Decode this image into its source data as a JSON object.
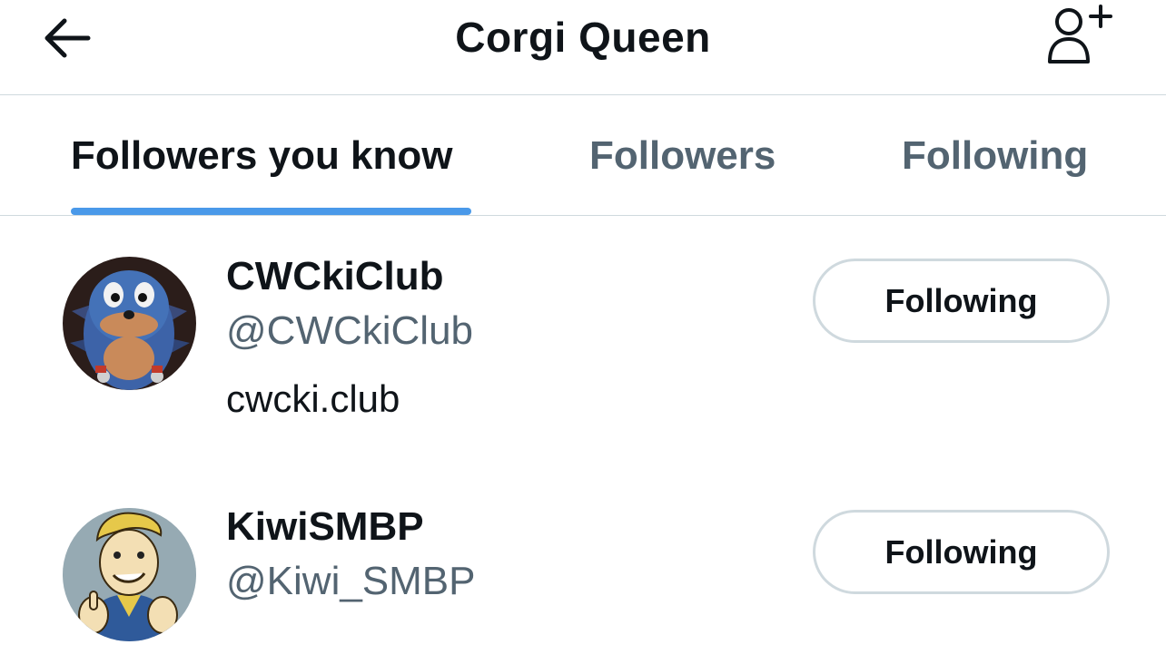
{
  "header": {
    "title": "Corgi Queen",
    "back_icon": "arrow-left-icon",
    "add_user_icon": "person-plus-icon"
  },
  "tabs": [
    {
      "label": "Followers you know",
      "active": true
    },
    {
      "label": "Followers",
      "active": false
    },
    {
      "label": "Following",
      "active": false
    }
  ],
  "accent_color": "#4a99e9",
  "users": [
    {
      "name": "CWCkiClub",
      "handle": "@CWCkiClub",
      "bio": "cwcki.club",
      "button_label": "Following",
      "avatar_icon": "blue-figure-avatar"
    },
    {
      "name": "KiwiSMBP",
      "handle": "@Kiwi_SMBP",
      "bio": "",
      "button_label": "Following",
      "avatar_icon": "cartoon-thumbs-up-avatar"
    }
  ]
}
